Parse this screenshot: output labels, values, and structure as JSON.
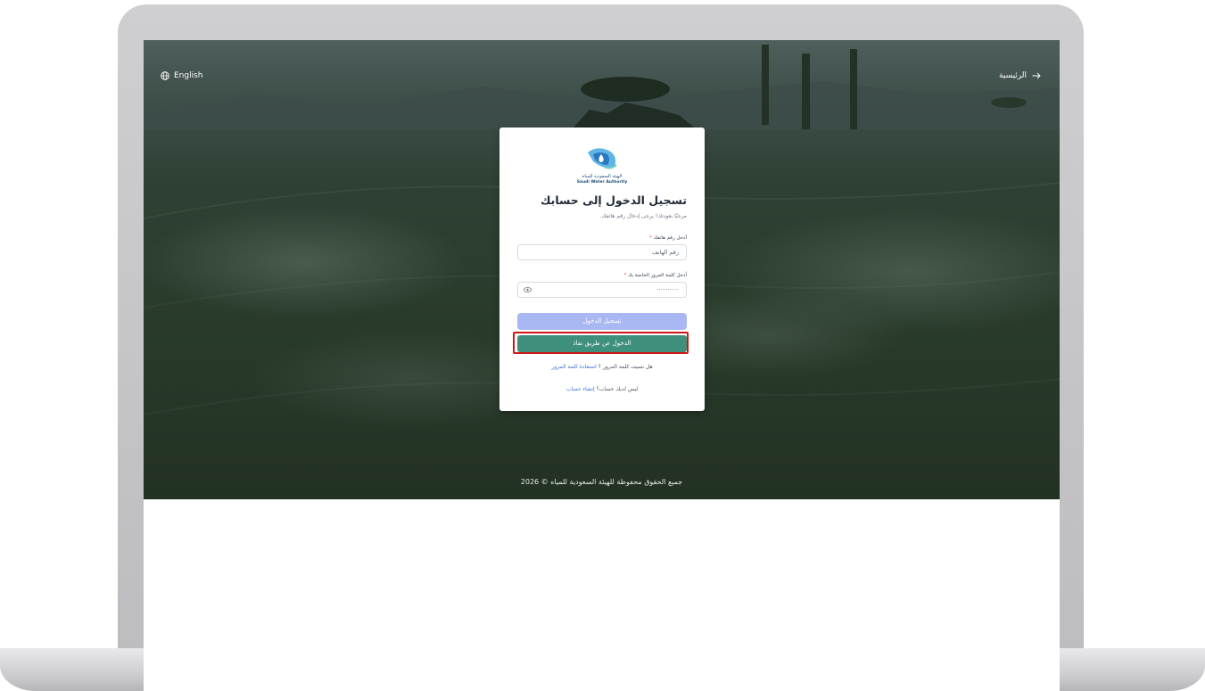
{
  "header": {
    "language_label": "English",
    "home_label": "الرئيسية"
  },
  "logo": {
    "arabic_name": "الهيئة السعودية للمياه",
    "english_name": "Saudi Water Authority"
  },
  "login": {
    "title": "تسجيل الدخول إلى حسابك",
    "subtitle": "مرحبًا بعودتك! يرجى إدخال رقم هاتفك.",
    "phone_label": "أدخل رقم هاتفك",
    "phone_placeholder": "رقم الهاتف",
    "password_label": "أدخل كلمة المرور الخاصة بك",
    "password_value": "············",
    "required_mark": "*",
    "login_button": "تسجيل الدخول",
    "nafath_button": "الدخول عن طريق نفاذ",
    "forgot_prompt": "هل نسيت كلمة المرور ؟",
    "forgot_link": "استعادة كلمة المرور",
    "signup_prompt": "ليس لديك حساب؟",
    "signup_link": "إنشاء حساب"
  },
  "footer": {
    "copyright": "جميع الحقوق محفوظة للهيئة السعودية للمياه © 2026"
  },
  "colors": {
    "nafath_green": "#3f8f7d",
    "login_blue_disabled": "#a9b8f2",
    "link_blue": "#3a6fd8",
    "highlight_red": "#d01616"
  }
}
